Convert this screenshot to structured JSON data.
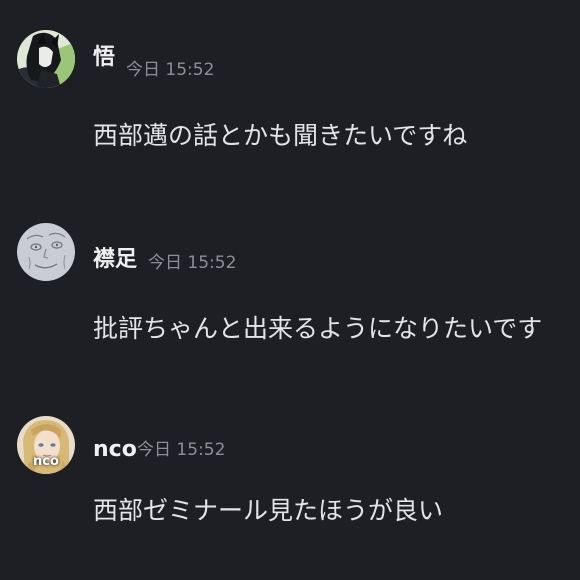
{
  "messages": [
    {
      "author": "悟",
      "timestamp": "今日 15:52",
      "text": "西部邁の話とかも聞きたいですね",
      "avatar": "avatar-dark-haired-character"
    },
    {
      "author": "襟足",
      "timestamp": "今日 15:52",
      "text": "批評ちゃんと出来るようになりたいです",
      "avatar": "avatar-sketch-face"
    },
    {
      "author": "nco",
      "timestamp": "今日 15:52",
      "text": "西部ゼミナール見たほうが良い",
      "avatar": "avatar-blonde-character",
      "avatar_caption": "nco"
    }
  ],
  "colors": {
    "background": "#1e1f24",
    "username": "#f0f0f2",
    "timestamp": "#8d8f96",
    "message_text": "#e3e4e8"
  }
}
